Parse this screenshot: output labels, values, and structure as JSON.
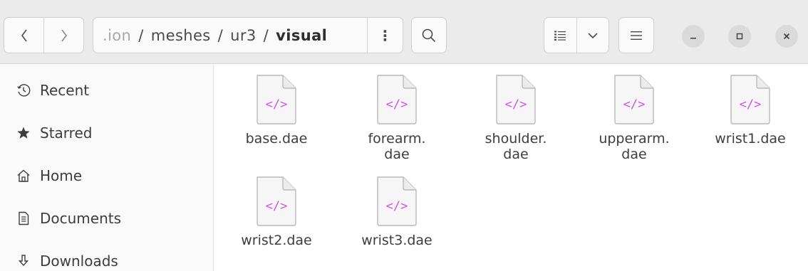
{
  "headerbar": {
    "path": {
      "truncated_prefix": ".ion",
      "segments": [
        "meshes",
        "ur3"
      ],
      "separator": "/",
      "current": "visual"
    },
    "path_menu_label": "⋮"
  },
  "sidebar": {
    "items": [
      {
        "label": "Recent",
        "icon": "clock-icon"
      },
      {
        "label": "Starred",
        "icon": "star-icon"
      },
      {
        "label": "Home",
        "icon": "home-icon"
      },
      {
        "label": "Documents",
        "icon": "document-icon"
      },
      {
        "label": "Downloads",
        "icon": "download-icon"
      }
    ]
  },
  "files": [
    {
      "name": "base.dae",
      "icon": "xml-file-icon"
    },
    {
      "name": "forearm.\ndae",
      "icon": "xml-file-icon"
    },
    {
      "name": "shoulder.\ndae",
      "icon": "xml-file-icon"
    },
    {
      "name": "upperarm.\ndae",
      "icon": "xml-file-icon"
    },
    {
      "name": "wrist1.dae",
      "icon": "xml-file-icon"
    },
    {
      "name": "wrist2.dae",
      "icon": "xml-file-icon"
    },
    {
      "name": "wrist3.dae",
      "icon": "xml-file-icon"
    }
  ],
  "file_icon_glyph": "</>",
  "colors": {
    "header_bg": "#ebebeb",
    "sidebar_bg": "#fafafa",
    "content_bg": "#ffffff",
    "file_icon_accent": "#d152e3"
  }
}
